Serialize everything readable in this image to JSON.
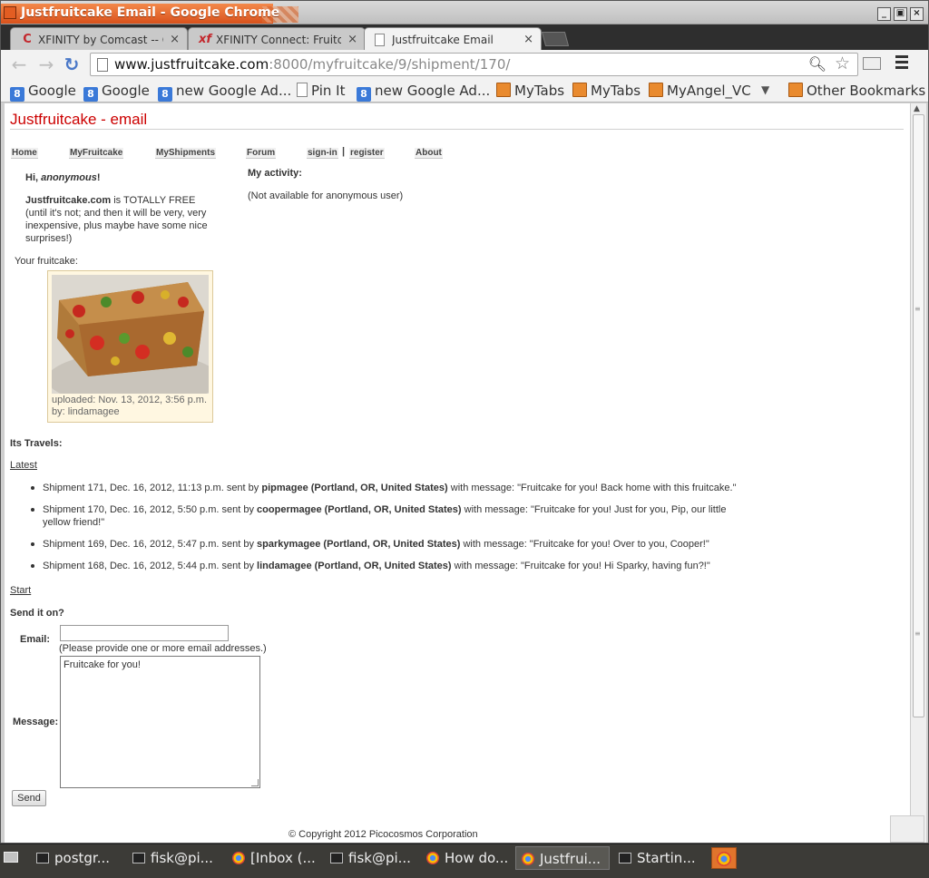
{
  "window": {
    "title": "Justfruitcake Email - Google Chrome"
  },
  "tabs": [
    {
      "label": "XFINITY by Comcast -- Offi",
      "icon": "comcast-icon"
    },
    {
      "label": "XFINITY Connect: Fruitcak",
      "icon": "xfinity-icon"
    },
    {
      "label": "Justfruitcake Email",
      "icon": "page-icon"
    }
  ],
  "omnibox": {
    "host": "www.justfruitcake.com",
    "path": ":8000/myfruitcake/9/shipment/170/"
  },
  "bookmarks": [
    {
      "label": "Google",
      "icon": "google-icon"
    },
    {
      "label": "Google",
      "icon": "google-icon"
    },
    {
      "label": "new Google Ad...",
      "icon": "google-icon"
    },
    {
      "label": "Pin It",
      "icon": "page-icon"
    },
    {
      "label": "new Google Ad...",
      "icon": "google-icon"
    },
    {
      "label": "MyTabs",
      "icon": "folder-icon"
    },
    {
      "label": "MyTabs",
      "icon": "folder-icon"
    },
    {
      "label": "MyAngel_VC",
      "icon": "folder-icon"
    },
    {
      "label": "Other Bookmarks",
      "icon": "folder-icon"
    }
  ],
  "page": {
    "title": "Justfruitcake - email",
    "nav": {
      "home": "Home",
      "myfruitcake": "MyFruitcake",
      "myshipments": "MyShipments",
      "forum": "Forum",
      "signin": "sign-in",
      "sep": "|",
      "register": "register",
      "about": "About"
    },
    "greeting_prefix": "Hi, ",
    "greeting_name": "anonymous",
    "greeting_suffix": "!",
    "brand": "Justfruitcake.com",
    "free_text": " is TOTALLY FREE (until it's not; and then it will be very, very inexpensive, plus maybe have some nice surprises!)",
    "your_fruitcake": "Your fruitcake:",
    "fruitcake": {
      "uploaded": "uploaded: Nov. 13, 2012, 3:56 p.m.",
      "by": "by: lindamagee"
    },
    "activity_heading": "My activity:",
    "activity_text": "(Not available for anonymous user)",
    "travels_heading": "Its Travels:",
    "latest_link": "Latest",
    "start_link": "Start",
    "shipments": [
      {
        "meta": "Shipment 171, Dec. 16, 2012, 11:13 p.m. sent by ",
        "sender": "pipmagee (Portland, OR, United States)",
        "message": " with message: \"Fruitcake for you! Back home with this fruitcake.\""
      },
      {
        "meta": "Shipment 170, Dec. 16, 2012, 5:50 p.m. sent by ",
        "sender": "coopermagee (Portland, OR, United States)",
        "message": " with message: \"Fruitcake for you! Just for you, Pip, our little yellow friend!\""
      },
      {
        "meta": "Shipment 169, Dec. 16, 2012, 5:47 p.m. sent by ",
        "sender": "sparkymagee (Portland, OR, United States)",
        "message": " with message: \"Fruitcake for you! Over to you, Cooper!\""
      },
      {
        "meta": "Shipment 168, Dec. 16, 2012, 5:44 p.m. sent by ",
        "sender": "lindamagee (Portland, OR, United States)",
        "message": " with message: \"Fruitcake for you! Hi Sparky, having fun?!\""
      }
    ],
    "send_heading": "Send it on?",
    "email_label": "Email:",
    "email_value": "",
    "email_hint": "(Please provide one or more email addresses.)",
    "message_label": "Message:",
    "message_value": "Fruitcake for you!",
    "send_button": "Send",
    "copyright": "© Copyright 2012 Picocosmos Corporation"
  },
  "taskbar": [
    {
      "label": "postgr...",
      "icon": "terminal-icon"
    },
    {
      "label": "fisk@pi...",
      "icon": "terminal-icon"
    },
    {
      "label": "[Inbox (...",
      "icon": "chrome-icon"
    },
    {
      "label": "fisk@pi...",
      "icon": "terminal-icon"
    },
    {
      "label": "How do...",
      "icon": "chrome-icon"
    },
    {
      "label": "Justfrui...",
      "icon": "chrome-icon",
      "active": true
    },
    {
      "label": "Startin...",
      "icon": "camera-icon"
    }
  ]
}
